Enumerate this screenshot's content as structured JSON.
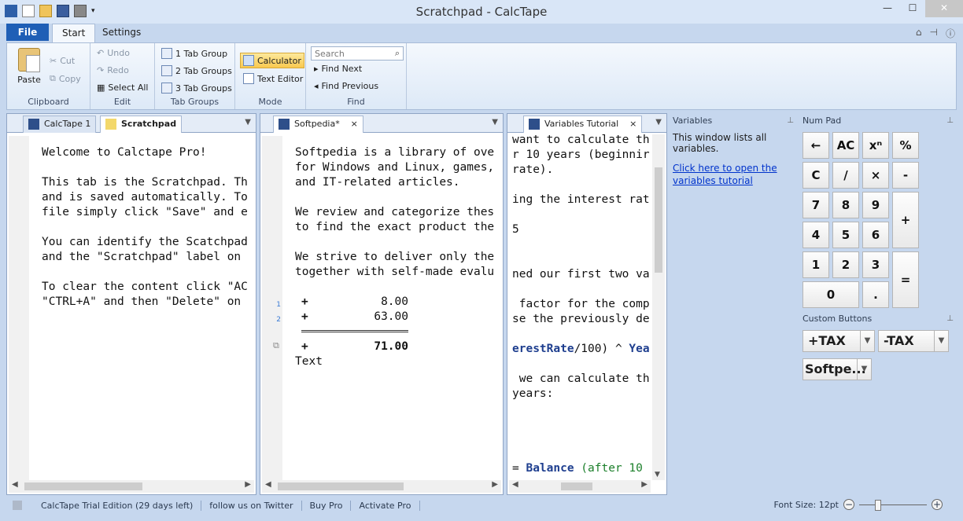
{
  "window": {
    "title": "Scratchpad - CalcTape"
  },
  "ribbon": {
    "file_tab": "File",
    "tabs": [
      "Start",
      "Settings"
    ],
    "clipboard": {
      "label": "Clipboard",
      "paste": "Paste",
      "cut": "Cut",
      "copy": "Copy"
    },
    "edit": {
      "label": "Edit",
      "undo": "Undo",
      "redo": "Redo",
      "select_all": "Select All"
    },
    "tab_group": {
      "label": "Tab Groups",
      "one": "1 Tab Group",
      "two": "2 Tab Groups",
      "three": "3 Tab Groups"
    },
    "mode": {
      "label": "Mode",
      "calculator": "Calculator",
      "text_editor": "Text Editor"
    },
    "find": {
      "label": "Find",
      "search_placeholder": "Search",
      "find_next": "Find Next",
      "find_previous": "Find Previous"
    }
  },
  "pane1": {
    "tabs": [
      "CalcTape 1",
      "Scratchpad"
    ],
    "lines": [
      "Welcome to Calctape Pro!",
      "",
      "This tab is the Scratchpad. Th",
      "and is saved automatically. To",
      "file simply click \"Save\" and e",
      "",
      "You can identify the Scatchpad",
      "and the \"Scratchpad\" label on ",
      "",
      "To clear the content click \"AC",
      "\"CTRL+A\" and then \"Delete\" on "
    ]
  },
  "pane2": {
    "tab": "Softpedia*",
    "tab_close": "×",
    "lines": [
      "Softpedia is a library of ove",
      "for Windows and Linux, games,",
      "and IT-related articles.",
      "",
      "We review and categorize thes",
      "to find the exact product the",
      "",
      "We strive to deliver only the",
      "together with self-made evalu"
    ],
    "calc_rows": [
      {
        "num": "1",
        "op": "+",
        "value": "8.00"
      },
      {
        "num": "2",
        "op": "+",
        "value": "63.00"
      }
    ],
    "total": {
      "op": "+",
      "value": "71.00"
    },
    "trailing": "Text"
  },
  "pane3": {
    "tab": "Variables Tutorial",
    "tab_close": "×",
    "lines": [
      {
        "text": "want to calculate th"
      },
      {
        "text": "r 10 years (beginnir"
      },
      {
        "text": "rate)."
      },
      {
        "text": ""
      },
      {
        "text": "ing the interest rat"
      },
      {
        "text": ""
      },
      {
        "text": "5"
      },
      {
        "text": ""
      },
      {
        "text": ""
      },
      {
        "text": "ned our first two va"
      },
      {
        "text": ""
      },
      {
        "text": " factor for the comp"
      },
      {
        "text": "se the previously de"
      },
      {
        "text": ""
      },
      {
        "html_kw": "erestRate",
        "rest": "/100) ^ ",
        "kw2": "Yea"
      },
      {
        "text": ""
      },
      {
        "text": " we can calculate th"
      },
      {
        "text": "years:"
      },
      {
        "text": ""
      },
      {
        "text": ""
      },
      {
        "text": ""
      },
      {
        "text": ""
      },
      {
        "eq": "= ",
        "kw": "Balance",
        "green": " (after 10"
      }
    ]
  },
  "variables": {
    "title": "Variables",
    "description": "This window lists all variables.",
    "link": "Click here to open the variables tutorial"
  },
  "numpad": {
    "title": "Num Pad",
    "keys": [
      "←",
      "AC",
      "xⁿ",
      "%",
      "C",
      "/",
      "×",
      "-",
      "7",
      "8",
      "9",
      "+",
      "4",
      "5",
      "6",
      "1",
      "2",
      "3",
      "=",
      "0",
      "."
    ]
  },
  "custom_buttons": {
    "title": "Custom Buttons",
    "buttons": [
      "+TAX",
      "-TAX",
      "Softpe..."
    ]
  },
  "status": {
    "trial": "CalcTape Trial Edition (29 days left)",
    "twitter": "follow us on Twitter",
    "buy": "Buy Pro",
    "activate": "Activate Pro",
    "font_size": "Font Size: 12pt"
  }
}
